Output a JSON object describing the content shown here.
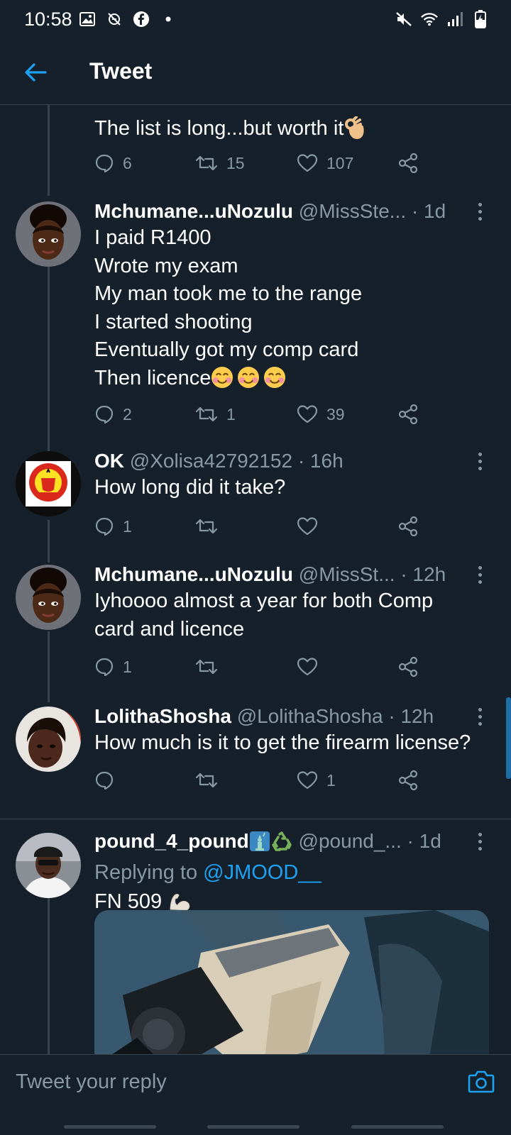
{
  "status_bar": {
    "time": "10:58",
    "left_icons": [
      "gallery-icon",
      "no-data-saver-icon",
      "facebook-icon",
      "dot-icon"
    ],
    "right_icons": [
      "mute-icon",
      "wifi-icon",
      "signal-icon",
      "battery-charging-icon"
    ]
  },
  "header": {
    "title": "Tweet",
    "back_icon": "arrow-left-icon"
  },
  "colors": {
    "background": "#15202b",
    "accent": "#1da1f2",
    "secondary_text": "#8899a6",
    "divider": "#38444d"
  },
  "tweets": [
    {
      "text": "The list is long...but worth it",
      "emoji": "ok-hand",
      "reply_count": "6",
      "retweet_count": "15",
      "like_count": "107"
    },
    {
      "name": "Mchumane...uNozulu",
      "handle": "@MissSte...",
      "time": "· 1d",
      "lines": [
        "I paid R1400",
        "Wrote my exam",
        "My man took me to the range",
        "I started shooting",
        "Eventually got my comp card",
        "Then licence"
      ],
      "emoji": "smiling-face x3",
      "reply_count": "2",
      "retweet_count": "1",
      "like_count": "39"
    },
    {
      "name": "OK",
      "handle": "@Xolisa42792152",
      "time": "· 16h",
      "text": "How long did it take?",
      "reply_count": "1",
      "retweet_count": "",
      "like_count": ""
    },
    {
      "name": "Mchumane...uNozulu",
      "handle": "@MissSt...",
      "time": "· 12h",
      "lines": [
        "Iyhoooo almost a year for both Comp",
        "card and licence"
      ],
      "reply_count": "1",
      "retweet_count": "",
      "like_count": ""
    },
    {
      "name": "LolithaShosha",
      "handle": "@LolithaShosha",
      "time": "· 12h",
      "text": "How much is it to get the firearm license?",
      "reply_count": "",
      "retweet_count": "",
      "like_count": "1"
    },
    {
      "name": "pound_4_pound",
      "name_emoji": "statue-of-liberty recycle",
      "handle": "@pound_...",
      "time": "· 1d",
      "replying_prefix": "Replying to",
      "replying_to": "@JMOOD__",
      "text": "FN 509",
      "emoji": "flexed-biceps"
    }
  ],
  "reply_bar": {
    "placeholder": "Tweet your reply",
    "camera_icon": "camera-icon"
  }
}
